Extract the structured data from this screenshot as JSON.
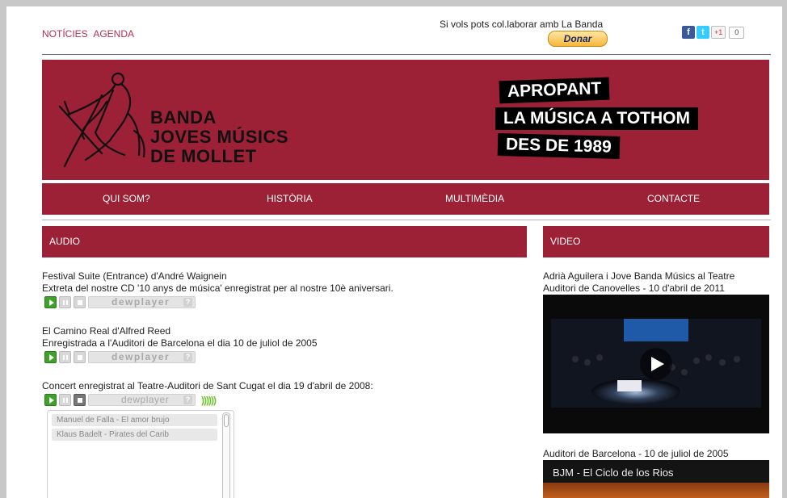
{
  "header": {
    "links": [
      "NOTÍCIES",
      "AGENDA"
    ],
    "collab_text": "Si vols pots col.laborar amb La Banda",
    "donate_label": "Donar",
    "social": {
      "facebook": "f",
      "twitter": "t",
      "gplus": "+1",
      "count": "0"
    }
  },
  "banner": {
    "name_lines": [
      "BANDA",
      "JOVES MÚSICS",
      "DE MOLLET"
    ],
    "slogan": [
      "APROPANT",
      "LA MÚSICA A TOTHOM",
      "DES DE 1989"
    ],
    "logo_icon": "violinist-logo-icon"
  },
  "nav": {
    "items": [
      "QUI SOM?",
      "HISTÒRIA",
      "MULTIMÈDIA",
      "CONTACTE"
    ]
  },
  "audio": {
    "title": "AUDIO",
    "tracks": [
      {
        "title": "Festival Suite (Entrance) d'André Waignein",
        "desc": "Extreta del nostre CD '10 anys de música' enregistrat per al nostre 10è aniversari.",
        "player": "dewplayer",
        "help": "?"
      },
      {
        "title": "El Camino Real d'Alfred Reed",
        "desc": "Enregistrada a l'Auditori de Barcelona el dia 10 de juliol de 2005",
        "player": "dewplayer",
        "help": "?"
      },
      {
        "title": "Concert enregistrat al Teatre-Auditori de Sant Cugat el dia 19 d'abril de 2008:",
        "player": "dewplayer",
        "help": "?",
        "volume": "))))))"
      }
    ],
    "playlist": [
      "Manuel de Falla - El amor brujo",
      "Klaus Badelt - Pirates del Carib"
    ]
  },
  "video": {
    "title": "VIDEO",
    "videos": [
      {
        "caption": [
          "Adrià Aguilera i Jove Banda Músics al Teatre",
          "Auditori de Canovelles - 10 d'abril de 2011"
        ]
      },
      {
        "caption": [
          "Auditori de Barcelona - 10 de juliol de 2005"
        ],
        "overlay_title": "BJM - El Ciclo de los Rios"
      }
    ]
  },
  "colors": {
    "brand": "#9c2036",
    "link": "#b03050",
    "play": "#3fa02a"
  }
}
